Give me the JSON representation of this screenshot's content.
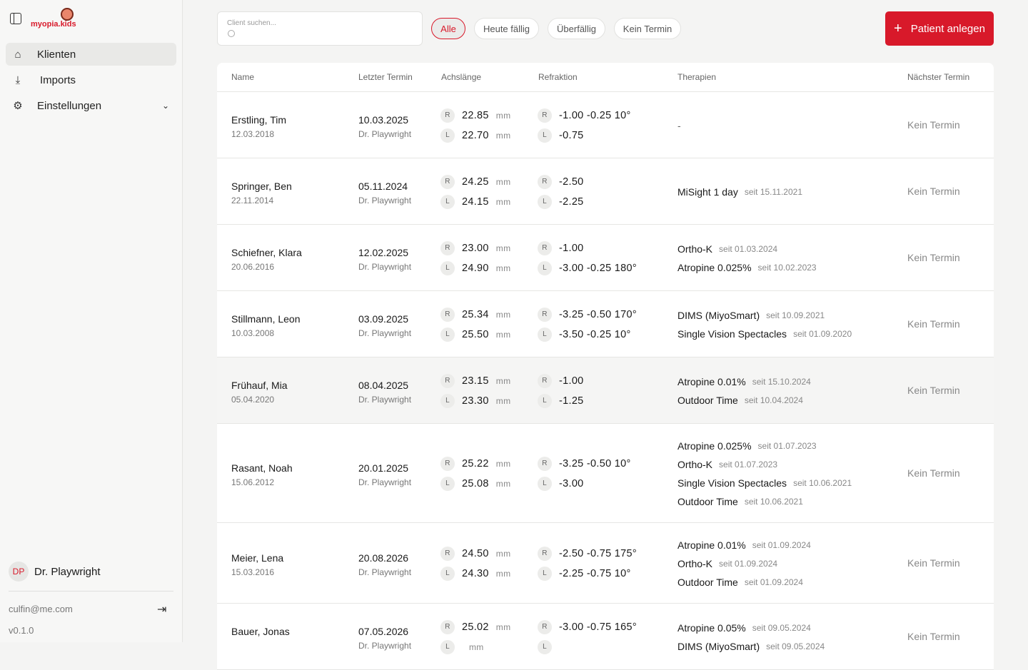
{
  "sidebar": {
    "logo": "myopia.kids",
    "nav": [
      {
        "label": "Klienten",
        "icon": "home-icon"
      },
      {
        "label": "Imports",
        "icon": "download-icon"
      },
      {
        "label": "Einstellungen",
        "icon": "gear-icon"
      }
    ],
    "user": {
      "initials": "DP",
      "name": "Dr. Playwright",
      "email": "culfin@me.com"
    },
    "version": "v0.1.0"
  },
  "toolbar": {
    "search_placeholder": "Client suchen...",
    "filters": [
      "Alle",
      "Heute fällig",
      "Überfällig",
      "Kein Termin"
    ],
    "add_label": "Patient anlegen"
  },
  "table": {
    "headers": [
      "Name",
      "Letzter Termin",
      "Achslänge",
      "Refraktion",
      "Therapien",
      "Nächster Termin"
    ],
    "unit": "mm",
    "rows": [
      {
        "name": "Erstling, Tim",
        "dob": "12.03.2018",
        "last": "10.03.2025",
        "doctor": "Dr. Playwright",
        "axR": "22.85",
        "axL": "22.70",
        "refR": "-1.00 -0.25 10°",
        "refL": "-0.75",
        "therapies": [],
        "empty": "-",
        "next": "Kein Termin"
      },
      {
        "name": "Springer, Ben",
        "dob": "22.11.2014",
        "last": "05.11.2024",
        "doctor": "Dr. Playwright",
        "axR": "24.25",
        "axL": "24.15",
        "refR": "-2.50",
        "refL": "-2.25",
        "therapies": [
          {
            "name": "MiSight 1 day",
            "since": "seit 15.11.2021"
          }
        ],
        "next": "Kein Termin"
      },
      {
        "name": "Schiefner, Klara",
        "dob": "20.06.2016",
        "last": "12.02.2025",
        "doctor": "Dr. Playwright",
        "axR": "23.00",
        "axL": "24.90",
        "refR": "-1.00",
        "refL": "-3.00 -0.25 180°",
        "therapies": [
          {
            "name": "Ortho-K",
            "since": "seit 01.03.2024"
          },
          {
            "name": "Atropine 0.025%",
            "since": "seit 10.02.2023"
          }
        ],
        "next": "Kein Termin"
      },
      {
        "name": "Stillmann, Leon",
        "dob": "10.03.2008",
        "last": "03.09.2025",
        "doctor": "Dr. Playwright",
        "axR": "25.34",
        "axL": "25.50",
        "refR": "-3.25 -0.50 170°",
        "refL": "-3.50 -0.25 10°",
        "therapies": [
          {
            "name": "DIMS (MiyoSmart)",
            "since": "seit 10.09.2021"
          },
          {
            "name": "Single Vision Spectacles",
            "since": "seit 01.09.2020"
          }
        ],
        "next": "Kein Termin"
      },
      {
        "name": "Frühauf, Mia",
        "dob": "05.04.2020",
        "last": "08.04.2025",
        "doctor": "Dr. Playwright",
        "axR": "23.15",
        "axL": "23.30",
        "refR": "-1.00",
        "refL": "-1.25",
        "therapies": [
          {
            "name": "Atropine 0.01%",
            "since": "seit 15.10.2024"
          },
          {
            "name": "Outdoor Time",
            "since": "seit 10.04.2024"
          }
        ],
        "next": "Kein Termin"
      },
      {
        "name": "Rasant, Noah",
        "dob": "15.06.2012",
        "last": "20.01.2025",
        "doctor": "Dr. Playwright",
        "axR": "25.22",
        "axL": "25.08",
        "refR": "-3.25 -0.50 10°",
        "refL": "-3.00",
        "therapies": [
          {
            "name": "Atropine 0.025%",
            "since": "seit 01.07.2023"
          },
          {
            "name": "Ortho-K",
            "since": "seit 01.07.2023"
          },
          {
            "name": "Single Vision Spectacles",
            "since": "seit 10.06.2021"
          },
          {
            "name": "Outdoor Time",
            "since": "seit 10.06.2021"
          }
        ],
        "next": "Kein Termin"
      },
      {
        "name": "Meier, Lena",
        "dob": "15.03.2016",
        "last": "20.08.2026",
        "doctor": "Dr. Playwright",
        "axR": "24.50",
        "axL": "24.30",
        "refR": "-2.50 -0.75 175°",
        "refL": "-2.25 -0.75 10°",
        "therapies": [
          {
            "name": "Atropine 0.01%",
            "since": "seit 01.09.2024"
          },
          {
            "name": "Ortho-K",
            "since": "seit 01.09.2024"
          },
          {
            "name": "Outdoor Time",
            "since": "seit 01.09.2024"
          }
        ],
        "next": "Kein Termin"
      },
      {
        "name": "Bauer, Jonas",
        "dob": "",
        "last": "07.05.2026",
        "doctor": "Dr. Playwright",
        "axR": "25.02",
        "axL": "",
        "refR": "-3.00 -0.75 165°",
        "refL": "",
        "therapies": [
          {
            "name": "Atropine 0.05%",
            "since": "seit 09.05.2024"
          },
          {
            "name": "DIMS (MiyoSmart)",
            "since": "seit 09.05.2024"
          }
        ],
        "next": "Kein Termin"
      }
    ]
  }
}
